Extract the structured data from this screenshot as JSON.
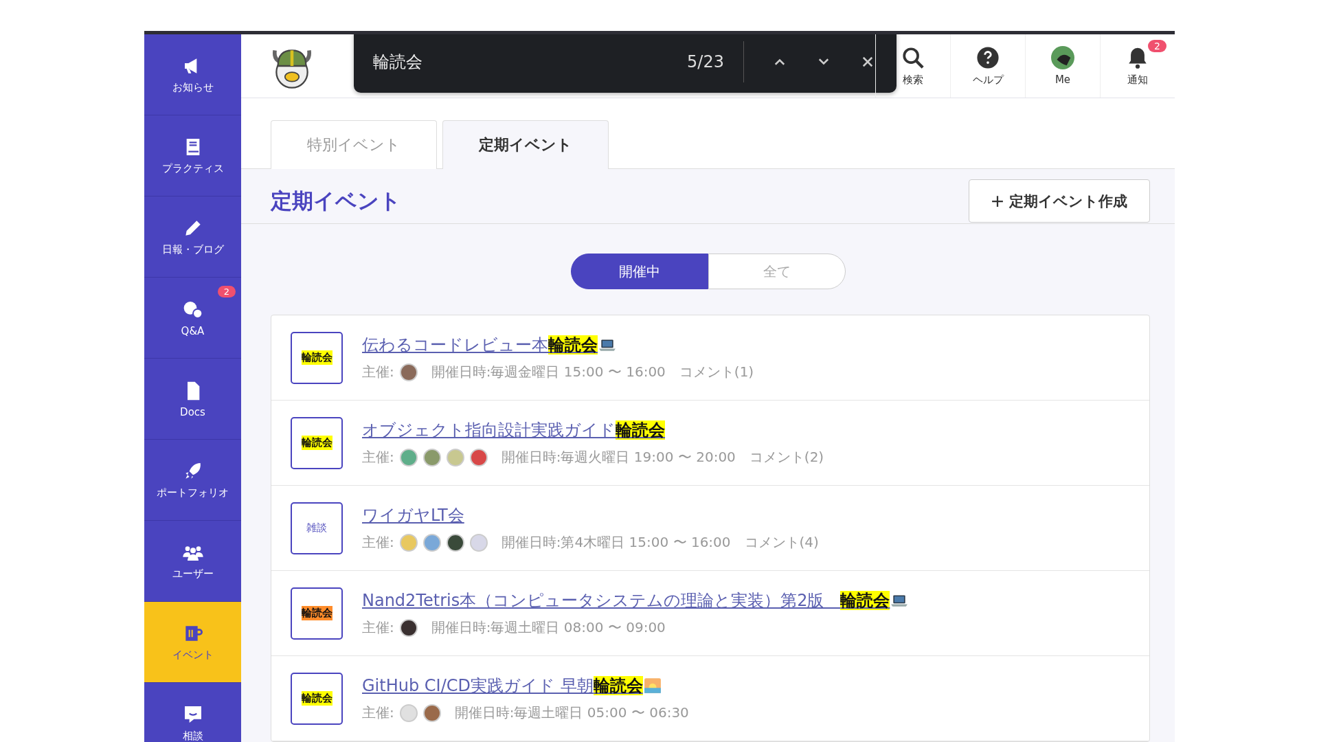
{
  "sidebar": {
    "items": [
      {
        "kind": "megaphone",
        "label": "お知らせ",
        "selected": false
      },
      {
        "kind": "book",
        "label": "プラクティス",
        "selected": false
      },
      {
        "kind": "pencil",
        "label": "日報・ブログ",
        "selected": false
      },
      {
        "kind": "qa",
        "label": "Q&A",
        "selected": false,
        "badge": "2"
      },
      {
        "kind": "doc",
        "label": "Docs",
        "selected": false
      },
      {
        "kind": "rocket",
        "label": "ポートフォリオ",
        "selected": false
      },
      {
        "kind": "users",
        "label": "ユーザー",
        "selected": false
      },
      {
        "kind": "mug",
        "label": "イベント",
        "selected": true
      },
      {
        "kind": "chat",
        "label": "相談",
        "selected": false
      }
    ]
  },
  "find_bar": {
    "query": "輪読会",
    "count": "5/23"
  },
  "header": {
    "items": [
      {
        "kind": "search",
        "label": "検索"
      },
      {
        "kind": "help",
        "label": "ヘルプ"
      },
      {
        "kind": "avatar",
        "label": "Me"
      },
      {
        "kind": "bell",
        "label": "通知",
        "badge": "2"
      }
    ]
  },
  "tabs": [
    {
      "label": "特別イベント",
      "selected": false
    },
    {
      "label": "定期イベント",
      "selected": true
    }
  ],
  "page_title": "定期イベント",
  "create_button": "定期イベント作成",
  "filter": [
    {
      "label": "開催中",
      "selected": true
    },
    {
      "label": "全て",
      "selected": false
    }
  ],
  "events": [
    {
      "badge": {
        "text": "輪読会",
        "matched": true,
        "current": false
      },
      "title": {
        "before": "伝わるコードレビュー本",
        "match": "輪読会",
        "kind": "laptop"
      },
      "organizer_label": "主催:",
      "organizers": [
        {
          "color": "#8a6a5a"
        }
      ],
      "schedule": "開催日時:毎週金曜日 15:00 〜 16:00",
      "comments": "コメント(1)"
    },
    {
      "badge": {
        "text": "輪読会",
        "matched": true,
        "current": false
      },
      "title": {
        "before": "オブジェクト指向設計実践ガイド",
        "match": "輪読会"
      },
      "organizer_label": "主催:",
      "organizers": [
        {
          "color": "#5fae8a"
        },
        {
          "color": "#8a9a6a"
        },
        {
          "color": "#c8c890"
        },
        {
          "color": "#d84848"
        }
      ],
      "schedule": "開催日時:毎週火曜日 19:00 〜 20:00",
      "comments": "コメント(2)"
    },
    {
      "badge": {
        "text": "雑談",
        "matched": false,
        "current": false
      },
      "title": {
        "before": "ワイガヤLT会"
      },
      "organizer_label": "主催:",
      "organizers": [
        {
          "color": "#e8c860"
        },
        {
          "color": "#7aa8d8"
        },
        {
          "color": "#3a4a3a"
        },
        {
          "color": "#d8d8e8"
        }
      ],
      "schedule": "開催日時:第4木曜日 15:00 〜 16:00",
      "comments": "コメント(4)"
    },
    {
      "badge": {
        "text": "輪読会",
        "matched": true,
        "current": true
      },
      "title": {
        "before": "Nand2Tetris本（コンピュータシステムの理論と実装）第2版　",
        "match": "輪読会",
        "kind": "laptop"
      },
      "organizer_label": "主催:",
      "organizers": [
        {
          "color": "#3a3030"
        }
      ],
      "schedule": "開催日時:毎週土曜日 08:00 〜 09:00"
    },
    {
      "badge": {
        "text": "輪読会",
        "matched": true,
        "current": false
      },
      "title": {
        "before": "GitHub CI/CD実践ガイド 早朝",
        "match": "輪読会",
        "kind": "sunrise"
      },
      "organizer_label": "主催:",
      "organizers": [
        {
          "color": "#e0e0e0"
        },
        {
          "color": "#9a6a4a"
        }
      ],
      "schedule": "開催日時:毎週土曜日 05:00 〜 06:30"
    }
  ]
}
